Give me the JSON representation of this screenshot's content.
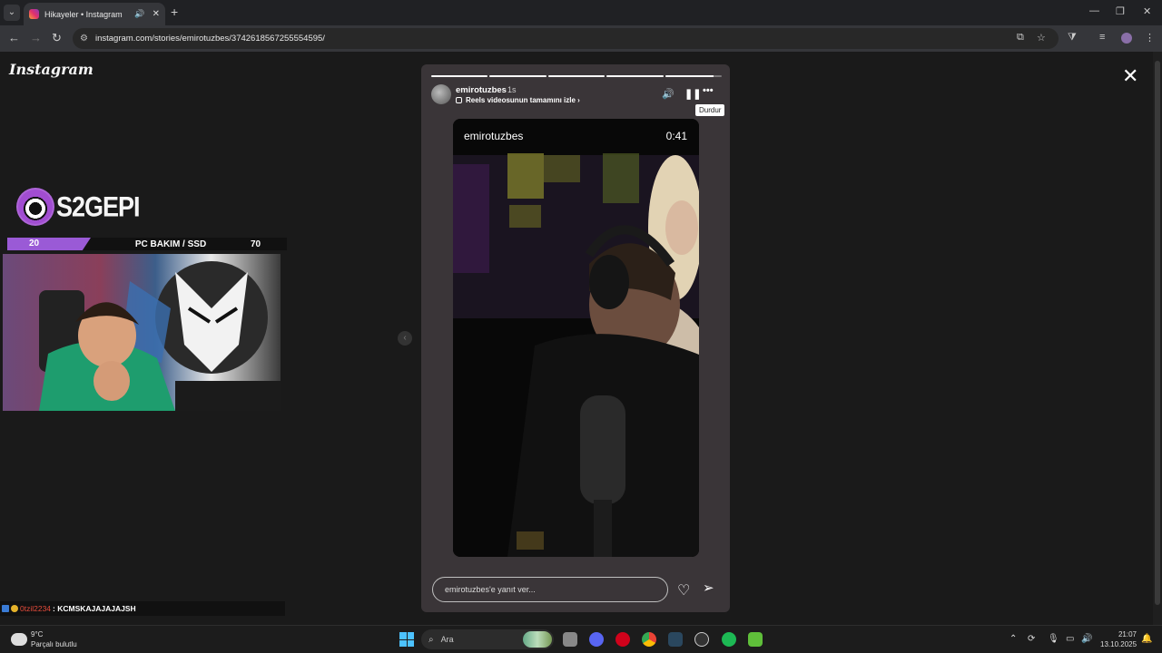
{
  "browser": {
    "tab_title": "Hikayeler • Instagram",
    "tab_close": "✕",
    "new_tab": "+",
    "url": "instagram.com/stories/emirotuzbes/3742618567255554595/"
  },
  "page": {
    "logo": "Instagram",
    "close_label": "✕"
  },
  "stream_overlay": {
    "brand": "S2GEPI",
    "promo_left": "20",
    "promo_label": "PC BAKIM / SSD",
    "promo_right": "70",
    "chat_user": "0tzil2234",
    "chat_message": ": KCMSKAJAJAJAJSH"
  },
  "story": {
    "username": "emirotuzbes",
    "time_ago": "1s",
    "reels_link": "Reels videosunun tamamını izle",
    "tooltip": "Durdur",
    "video_username": "emirotuzbes",
    "video_duration": "0:41",
    "reply_placeholder": "emirotuzbes'e yanıt ver...",
    "progress": [
      1,
      1,
      1,
      1,
      0.85
    ]
  },
  "taskbar": {
    "weather_temp": "9°C",
    "weather_desc": "Parçalı bulutlu",
    "search_placeholder": "Ara",
    "time": "21:07",
    "date": "13.10.2025"
  }
}
